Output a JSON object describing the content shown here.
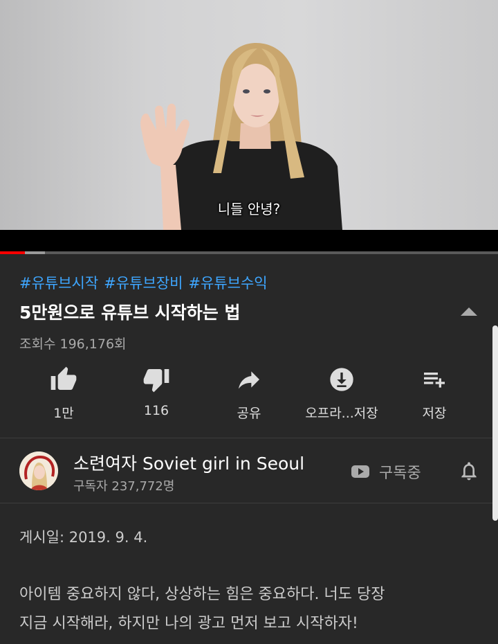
{
  "video": {
    "subtitle": "니들 안녕?",
    "progress_percent": 5,
    "buffer_percent": 9
  },
  "info": {
    "hashtags": [
      "#유튜브시작",
      "#유튜브장비",
      "#유튜브수익"
    ],
    "title": "5만원으로 유튜브 시작하는 법",
    "views": "조회수 196,176회"
  },
  "actions": {
    "like": {
      "label": "1만",
      "icon": "thumbs-up-icon"
    },
    "dislike": {
      "label": "116",
      "icon": "thumbs-down-icon"
    },
    "share": {
      "label": "공유",
      "icon": "share-icon"
    },
    "download": {
      "label": "오프라...저장",
      "icon": "download-icon"
    },
    "save": {
      "label": "저장",
      "icon": "playlist-add-icon"
    }
  },
  "channel": {
    "name": "소련여자 Soviet girl in Seoul",
    "subscribers": "구독자 237,772명",
    "subscribe_label": "구독중"
  },
  "description": {
    "posted": "게시일: 2019. 9. 4.",
    "line1": "아이템 중요하지 않다, 상상하는 힘은 중요하다. 너도 당장",
    "line2": "지금 시작해라, 하지만 나의 광고 먼저 보고 시작하자!"
  },
  "colors": {
    "background": "#282828",
    "hashtag": "#3ea6ff",
    "progress": "#ff0000",
    "secondary_text": "#aaaaaa"
  }
}
